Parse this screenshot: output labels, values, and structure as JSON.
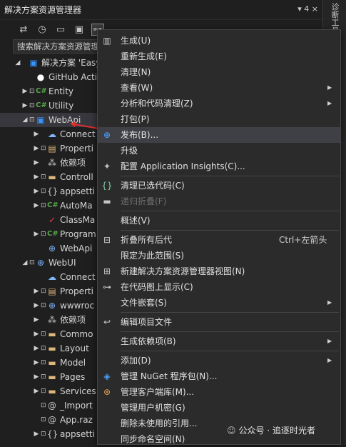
{
  "window": {
    "title": "解决方案资源管理器",
    "pin": "▾ 4 ×"
  },
  "side_panel": {
    "tab": "诊断工具"
  },
  "search": {
    "text": "搜索解决方案资源管理"
  },
  "tree": [
    {
      "name": "tree-solution",
      "label": "解决方案 'Easy",
      "icon": "▣",
      "icon_name": "solution-icon",
      "icls": "proj",
      "indent": 0,
      "exp": "◢",
      "lock": false
    },
    {
      "name": "tree-github",
      "label": "GitHub Acti",
      "icon": "●",
      "icon_name": "github-icon",
      "icls": "gh",
      "indent": 1,
      "exp": "",
      "lock": false
    },
    {
      "name": "tree-entity",
      "label": "Entity",
      "icon": "C#",
      "icon_name": "csharp-project-icon",
      "icls": "cs",
      "indent": 1,
      "exp": "▶",
      "lock": true
    },
    {
      "name": "tree-utility",
      "label": "Utility",
      "icon": "C#",
      "icon_name": "csharp-project-icon",
      "icls": "cs",
      "indent": 1,
      "exp": "▶",
      "lock": true
    },
    {
      "name": "tree-webapi",
      "label": "WebApi",
      "icon": "▣",
      "icon_name": "web-project-icon",
      "icls": "proj",
      "indent": 1,
      "exp": "◢",
      "lock": true,
      "selected": true
    },
    {
      "name": "tree-connected",
      "label": "Connect",
      "icon": "☁",
      "icon_name": "connected-services-icon",
      "icls": "web",
      "indent": 2,
      "exp": "▶",
      "lock": false
    },
    {
      "name": "tree-properties",
      "label": "Properti",
      "icon": "▤",
      "icon_name": "properties-folder-icon",
      "icls": "folder",
      "indent": 2,
      "exp": "▶",
      "lock": true
    },
    {
      "name": "tree-deps",
      "label": "依赖项",
      "icon": "⁂",
      "icon_name": "dependencies-icon",
      "icls": "cfg",
      "indent": 2,
      "exp": "▶",
      "lock": false
    },
    {
      "name": "tree-controllers",
      "label": "Controll",
      "icon": "▬",
      "icon_name": "folder-icon",
      "icls": "folder",
      "indent": 2,
      "exp": "▶",
      "lock": true
    },
    {
      "name": "tree-appsettings",
      "label": "appsetti",
      "icon": "{}",
      "icon_name": "json-file-icon",
      "icls": "cfg",
      "indent": 2,
      "exp": "▶",
      "lock": true
    },
    {
      "name": "tree-automapper",
      "label": "AutoMa",
      "icon": "C#",
      "icon_name": "csharp-file-icon",
      "icls": "cs",
      "indent": 2,
      "exp": "▶",
      "lock": true
    },
    {
      "name": "tree-classmap",
      "label": "ClassMa",
      "icon": "✓",
      "icon_name": "checked-file-icon",
      "icls": "red",
      "indent": 2,
      "exp": "",
      "lock": false
    },
    {
      "name": "tree-program",
      "label": "Program",
      "icon": "C#",
      "icon_name": "csharp-file-icon",
      "icls": "cs",
      "indent": 2,
      "exp": "▶",
      "lock": true
    },
    {
      "name": "tree-webapi-http",
      "label": "WebApi",
      "icon": "⊕",
      "icon_name": "http-file-icon",
      "icls": "web",
      "indent": 2,
      "exp": "",
      "lock": false
    },
    {
      "name": "tree-webui",
      "label": "WebUI",
      "icon": "⊕",
      "icon_name": "web-project-icon",
      "icls": "web",
      "indent": 1,
      "exp": "◢",
      "lock": true
    },
    {
      "name": "tree-connected-2",
      "label": "Connect",
      "icon": "☁",
      "icon_name": "connected-services-icon",
      "icls": "web",
      "indent": 2,
      "exp": "",
      "lock": false
    },
    {
      "name": "tree-properties-2",
      "label": "Properti",
      "icon": "▤",
      "icon_name": "properties-folder-icon",
      "icls": "folder",
      "indent": 2,
      "exp": "▶",
      "lock": true
    },
    {
      "name": "tree-wwwroot",
      "label": "wwwroc",
      "icon": "⊕",
      "icon_name": "globe-icon",
      "icls": "web",
      "indent": 2,
      "exp": "▶",
      "lock": true
    },
    {
      "name": "tree-deps-2",
      "label": "依赖项",
      "icon": "⁂",
      "icon_name": "dependencies-icon",
      "icls": "cfg",
      "indent": 2,
      "exp": "▶",
      "lock": false
    },
    {
      "name": "tree-common",
      "label": "Commo",
      "icon": "▬",
      "icon_name": "folder-icon",
      "icls": "folder",
      "indent": 2,
      "exp": "▶",
      "lock": true
    },
    {
      "name": "tree-layout",
      "label": "Layout",
      "icon": "▬",
      "icon_name": "folder-icon",
      "icls": "folder",
      "indent": 2,
      "exp": "▶",
      "lock": true
    },
    {
      "name": "tree-model",
      "label": "Model",
      "icon": "▬",
      "icon_name": "folder-icon",
      "icls": "folder",
      "indent": 2,
      "exp": "▶",
      "lock": true
    },
    {
      "name": "tree-pages",
      "label": "Pages",
      "icon": "▬",
      "icon_name": "folder-icon",
      "icls": "folder",
      "indent": 2,
      "exp": "▶",
      "lock": true
    },
    {
      "name": "tree-services",
      "label": "Services",
      "icon": "▬",
      "icon_name": "folder-icon",
      "icls": "folder",
      "indent": 2,
      "exp": "▶",
      "lock": true
    },
    {
      "name": "tree-imports",
      "label": "_Import",
      "icon": "@",
      "icon_name": "razor-file-icon",
      "icls": "cfg",
      "indent": 2,
      "exp": "",
      "lock": true
    },
    {
      "name": "tree-app",
      "label": "App.raz",
      "icon": "@",
      "icon_name": "razor-file-icon",
      "icls": "cfg",
      "indent": 2,
      "exp": "",
      "lock": true
    },
    {
      "name": "tree-appsettings-2",
      "label": "appsetti",
      "icon": "{}",
      "icon_name": "json-file-icon",
      "icls": "cfg",
      "indent": 2,
      "exp": "▶",
      "lock": true
    }
  ],
  "context_menu": {
    "items": [
      {
        "name": "menu-build",
        "label": "生成(U)",
        "icon": "▥",
        "icon_name": "build-icon"
      },
      {
        "name": "menu-rebuild",
        "label": "重新生成(E)"
      },
      {
        "name": "menu-clean",
        "label": "清理(N)"
      },
      {
        "name": "menu-view",
        "label": "查看(W)",
        "submenu": true
      },
      {
        "name": "menu-analyze",
        "label": "分析和代码清理(Z)",
        "submenu": true
      },
      {
        "name": "menu-pack",
        "label": "打包(P)"
      },
      {
        "name": "menu-publish",
        "label": "发布(B)...",
        "icon": "⊕",
        "icon_name": "globe-icon",
        "highlight": true
      },
      {
        "name": "menu-upgrade",
        "label": "升级"
      },
      {
        "name": "menu-app-insights",
        "label": "配置 Application Insights(C)...",
        "icon": "✦",
        "icon_name": "app-insights-icon"
      },
      {
        "sep": true
      },
      {
        "name": "menu-clean-code",
        "label": "清理已选代码(C)",
        "icon": "{}",
        "icon_name": "code-cleanup-icon"
      },
      {
        "name": "menu-fold",
        "label": "递归折叠(F)",
        "icon": "▬",
        "icon_name": "collapse-recursive-icon",
        "disabled": true
      },
      {
        "sep": true
      },
      {
        "name": "menu-overview",
        "label": "概述(V)"
      },
      {
        "sep": true
      },
      {
        "name": "menu-collapse-all",
        "label": "折叠所有后代",
        "icon": "⊟",
        "icon_name": "collapse-all-icon",
        "shortcut": "Ctrl+左箭头"
      },
      {
        "name": "menu-scope",
        "label": "限定为此范围(S)"
      },
      {
        "name": "menu-new-view",
        "label": "新建解决方案资源管理器视图(N)",
        "icon": "⊞",
        "icon_name": "new-view-icon"
      },
      {
        "name": "menu-code-map",
        "label": "在代码图上显示(C)",
        "icon": "⊶",
        "icon_name": "code-map-icon"
      },
      {
        "name": "menu-file-nesting",
        "label": "文件嵌套(S)",
        "submenu": true
      },
      {
        "sep": true
      },
      {
        "name": "menu-edit-project",
        "label": "编辑项目文件",
        "icon": "↩",
        "icon_name": "edit-project-icon"
      },
      {
        "sep": true
      },
      {
        "name": "menu-build-deps",
        "label": "生成依赖项(B)",
        "submenu": true
      },
      {
        "sep": true
      },
      {
        "name": "menu-add",
        "label": "添加(D)",
        "submenu": true
      },
      {
        "name": "menu-nuget",
        "label": "管理 NuGet 程序包(N)...",
        "icon": "◈",
        "icon_name": "nuget-icon"
      },
      {
        "name": "menu-client-libs",
        "label": "管理客户端库(M)...",
        "icon": "⊛",
        "icon_name": "client-libs-icon"
      },
      {
        "name": "menu-user-secrets",
        "label": "管理用户机密(G)"
      },
      {
        "name": "menu-remove-refs",
        "label": "删除未使用的引用..."
      },
      {
        "name": "menu-sync-namespaces",
        "label": "同步命名空间(N)"
      }
    ]
  },
  "watermark": {
    "text": "公众号 · 追逐时光者"
  }
}
